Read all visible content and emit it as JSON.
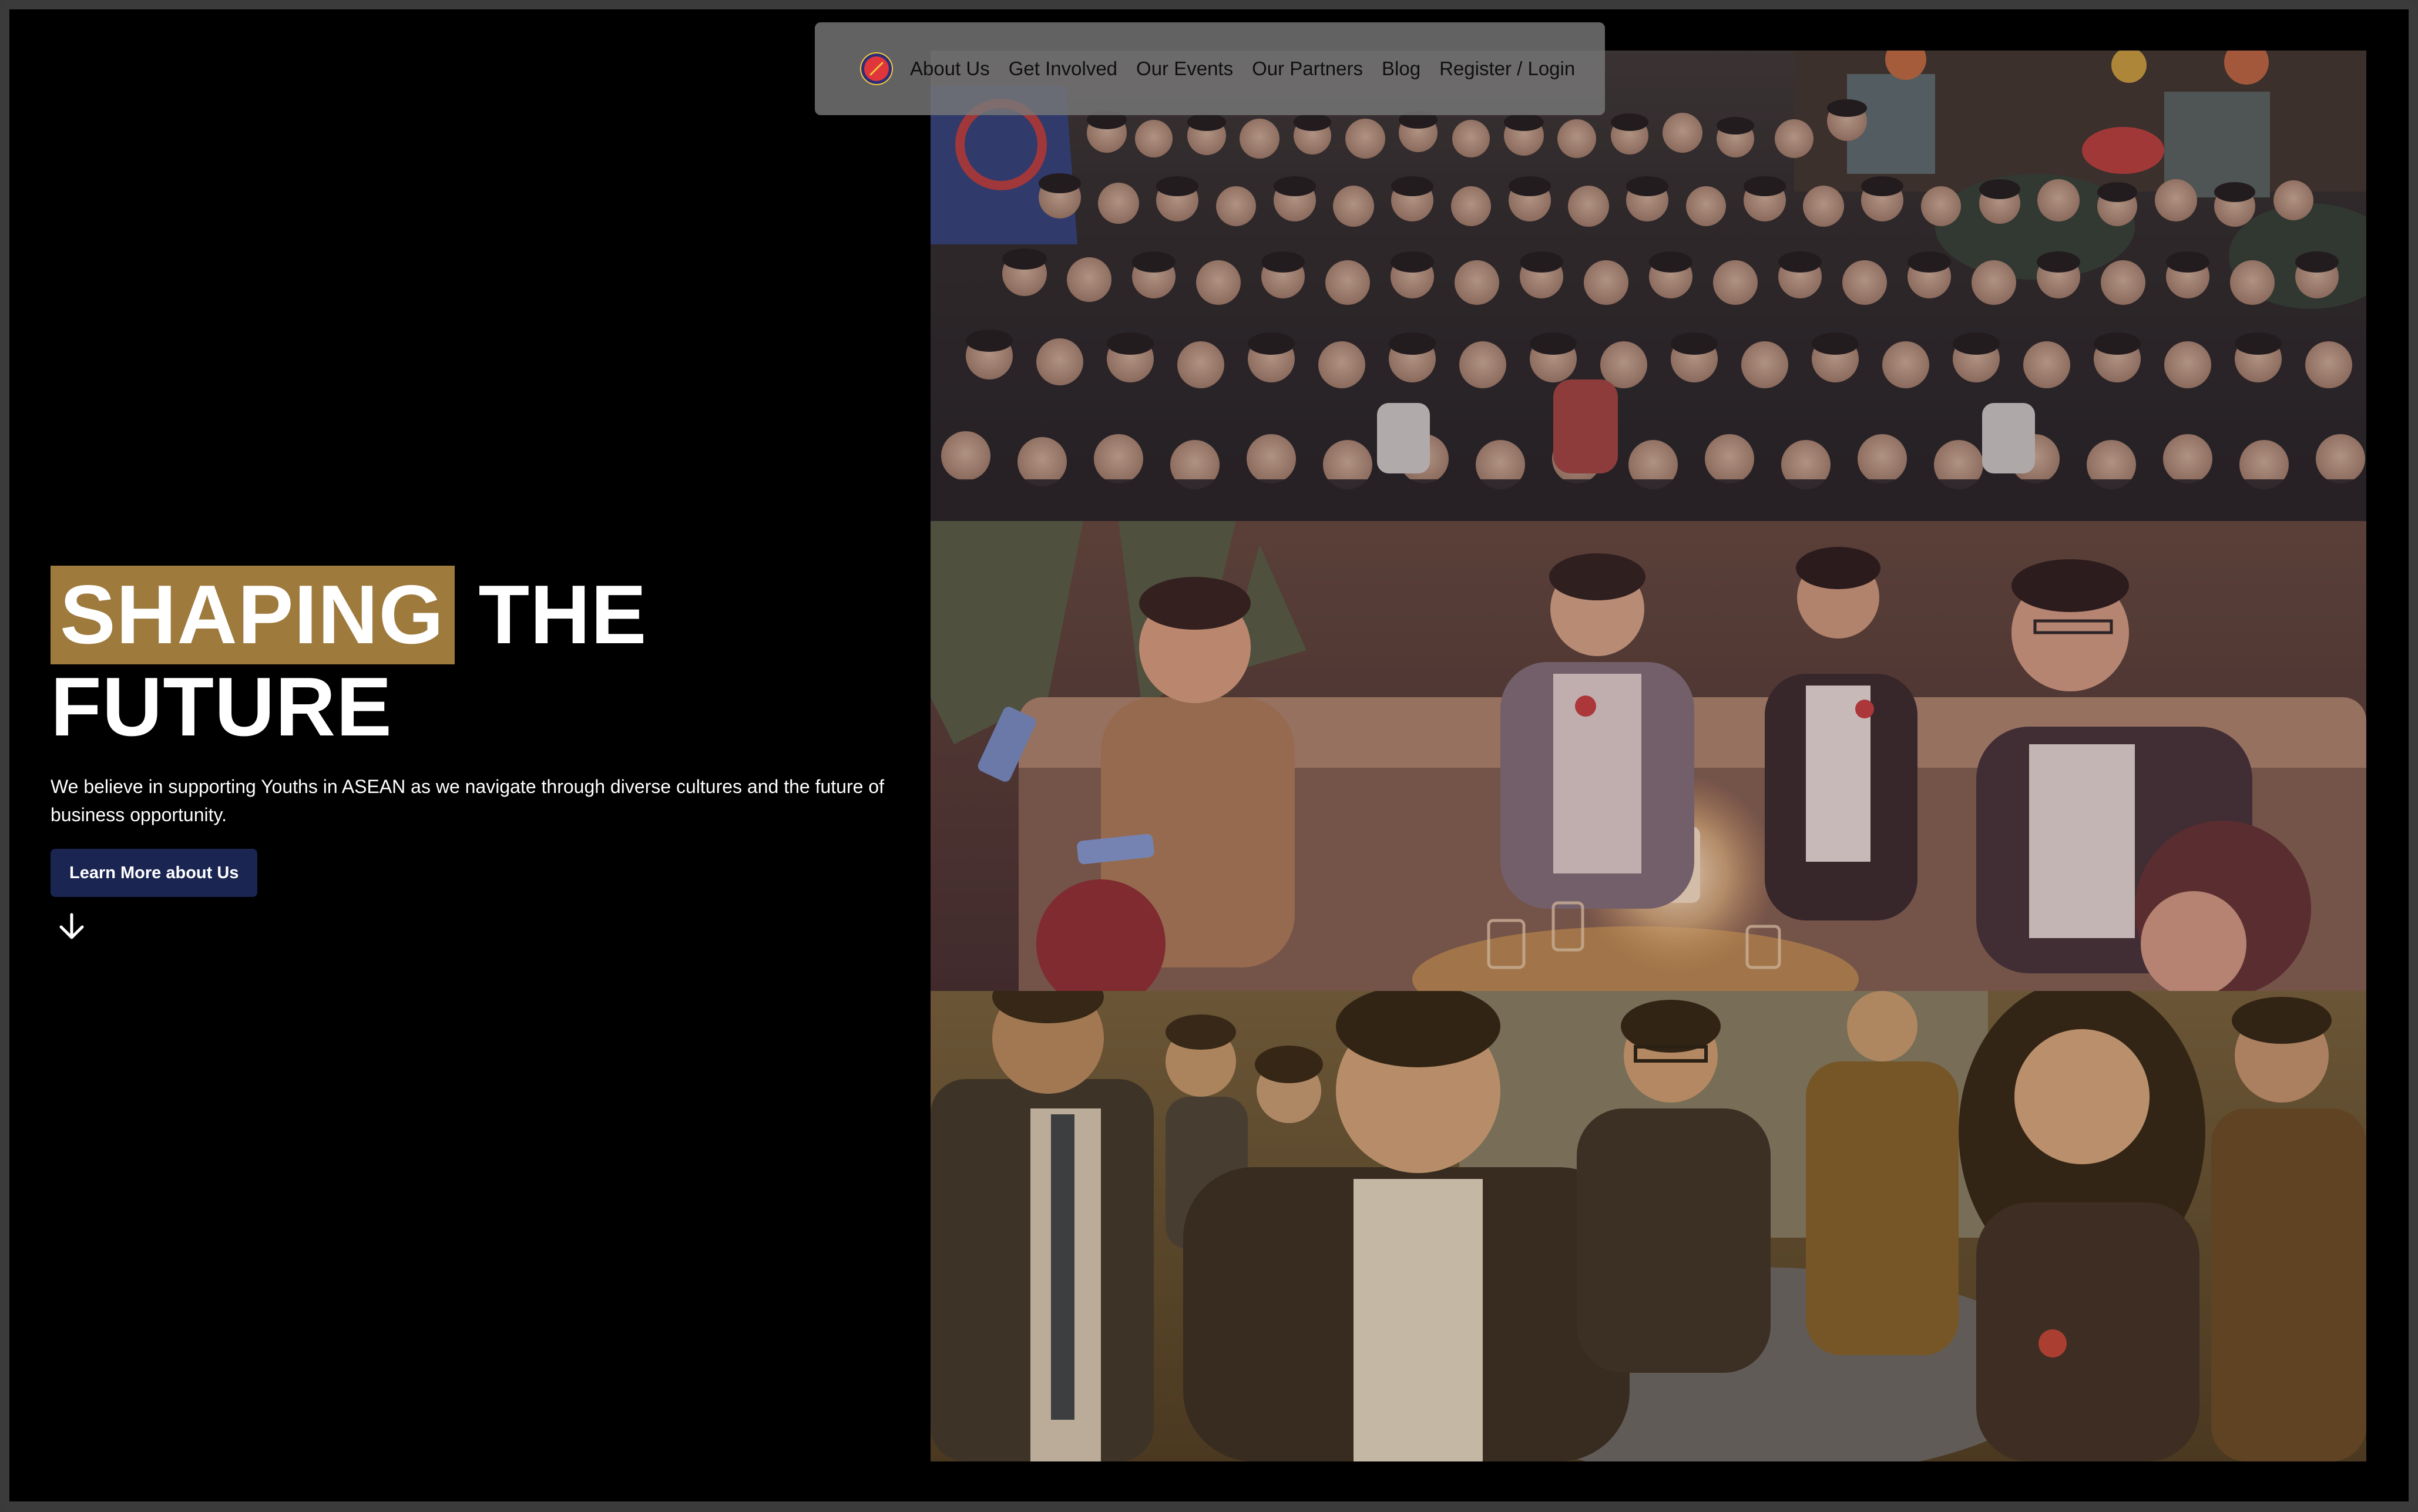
{
  "nav": {
    "logo": "asean-circle-logo",
    "items": [
      {
        "label": "About Us"
      },
      {
        "label": "Get Involved"
      },
      {
        "label": "Our Events"
      },
      {
        "label": "Our Partners"
      },
      {
        "label": "Blog"
      },
      {
        "label": "Register / Login"
      }
    ]
  },
  "hero": {
    "headline_highlight": "SHAPING",
    "headline_rest": "THE",
    "headline_line2": "FUTURE",
    "tagline": "We believe in supporting Youths in ASEAN as we navigate through diverse cultures and the future of business opportunity.",
    "cta_label": "Learn More about Us",
    "scroll_icon": "arrow-down-icon"
  },
  "colors": {
    "highlight": "#9e7a3c",
    "cta_background": "#1a2552",
    "page_background": "#000000",
    "nav_background": "#787878"
  },
  "photos": [
    {
      "name": "group-photo-crowd"
    },
    {
      "name": "lounge-conversation-photo"
    },
    {
      "name": "networking-event-photo"
    }
  ]
}
